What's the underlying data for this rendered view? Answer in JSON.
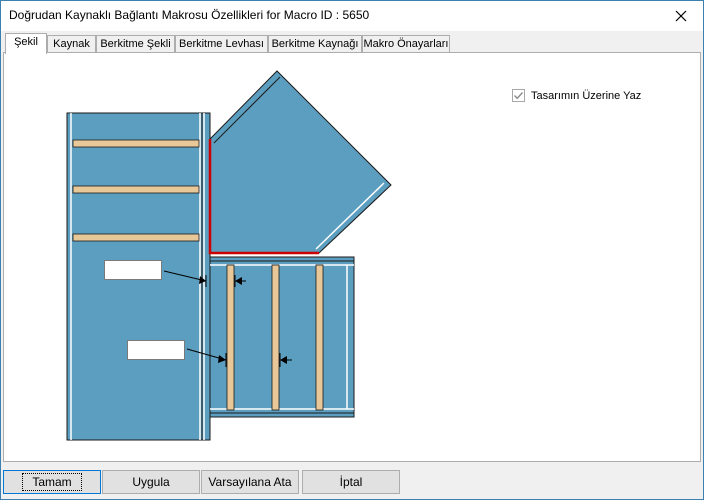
{
  "window": {
    "title": "Doğrudan Kaynaklı Bağlantı Makrosu Özellikleri for Macro ID : 5650"
  },
  "tabs": [
    {
      "label": "Şekil",
      "active": true
    },
    {
      "label": "Kaynak",
      "active": false
    },
    {
      "label": "Berkitme Şekli",
      "active": false
    },
    {
      "label": "Berkitme Levhası",
      "active": false
    },
    {
      "label": "Berkitme Kaynağı",
      "active": false
    },
    {
      "label": "Makro Önayarları",
      "active": false
    }
  ],
  "options": {
    "draw_on_design_label": "Tasarımın Üzerine Yaz",
    "draw_on_design_checked": true
  },
  "inputs": {
    "weld_size_1": "",
    "weld_size_2": ""
  },
  "buttons": {
    "ok": "Tamam",
    "apply": "Uygula",
    "defaults": "Varsayılana Ata",
    "cancel": "İptal"
  },
  "colors": {
    "steel": "#5c9ec0",
    "stiffener": "#e8c898",
    "weld": "#cc0000",
    "edge": "#1a1a1a"
  }
}
